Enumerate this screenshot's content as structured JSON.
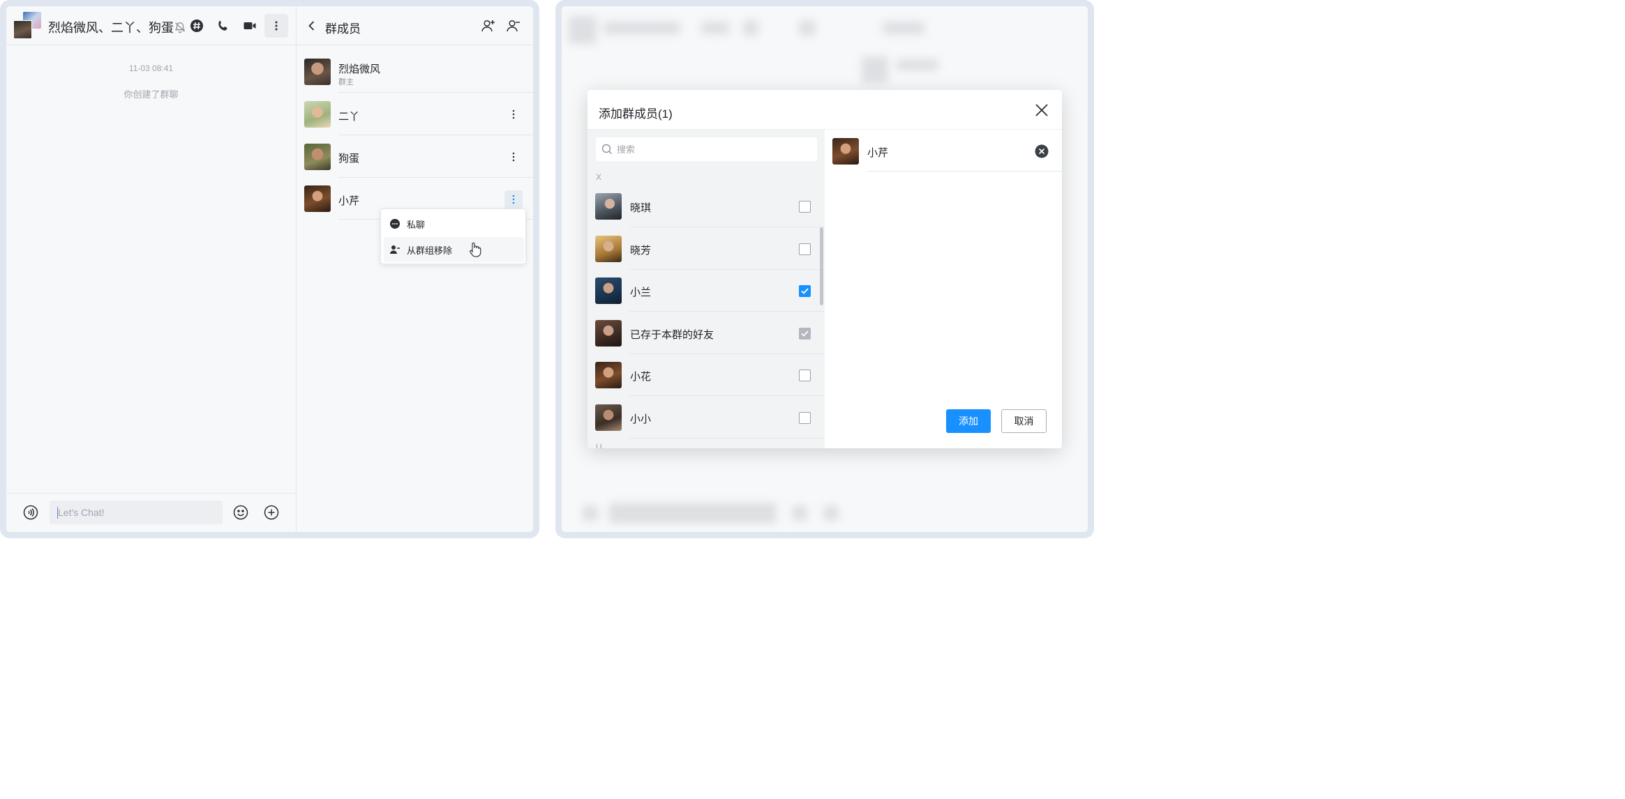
{
  "chat": {
    "title": "烈焰微风、二丫、狗蛋",
    "time": "11-03 08:41",
    "system_message": "你创建了群聊",
    "input_placeholder": "Let's Chat!",
    "icons": [
      "mute-icon",
      "hashtag-icon",
      "phone-icon",
      "video-icon",
      "more-vertical-icon",
      "voice-icon",
      "emoji-icon",
      "plus-circle-icon"
    ]
  },
  "members": {
    "title": "群成员",
    "list": [
      {
        "name": "烈焰微风",
        "role": "群主"
      },
      {
        "name": "二丫"
      },
      {
        "name": "狗蛋"
      },
      {
        "name": "小芹"
      }
    ],
    "context_menu": {
      "items": [
        {
          "label": "私聊",
          "icon": "chat-bubble-icon"
        },
        {
          "label": "从群组移除",
          "icon": "remove-user-icon"
        }
      ]
    }
  },
  "dialog": {
    "title": "添加群成员(1)",
    "search_placeholder": "搜索",
    "section_x": "X",
    "section_u": "U",
    "candidates": [
      {
        "name": "晓琪",
        "state": "unchecked"
      },
      {
        "name": "晓芳",
        "state": "unchecked"
      },
      {
        "name": "小兰",
        "state": "checked"
      },
      {
        "name": "已存于本群的好友",
        "state": "disabled-checked"
      },
      {
        "name": "小花",
        "state": "unchecked"
      },
      {
        "name": "小小",
        "state": "unchecked"
      }
    ],
    "selected": [
      {
        "name": "小芹"
      }
    ],
    "add_label": "添加",
    "cancel_label": "取消"
  },
  "colors": {
    "accent": "#1890ff",
    "frame": "#dfe6ef",
    "panel_bg": "#f7f8f9"
  }
}
